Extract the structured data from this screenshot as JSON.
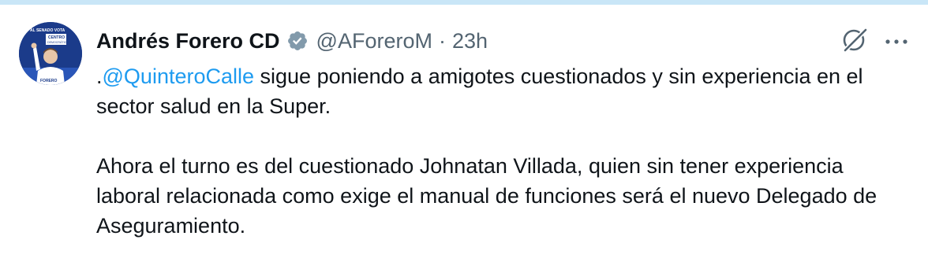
{
  "colors": {
    "accent": "#1d9bf0",
    "verified": "#829aab",
    "secondary_text": "#536471"
  },
  "author": {
    "display_name": "Andrés Forero CD",
    "handle": "@AForeroM",
    "separator": "·",
    "time": "23h",
    "verified_icon": "verified-badge-icon",
    "avatar_text": [
      "AL SENADO VOTA",
      "CENTRO",
      "DEMOCRÁTICO",
      "FORERO"
    ]
  },
  "actions": {
    "grok_icon": "grok-icon",
    "more_icon": "more-options-icon"
  },
  "tweet": {
    "line1_prefix": ".",
    "mention": "@QuinteroCalle",
    "line1_rest": " sigue poniendo a amigotes cuestionados y sin experiencia en el sector salud en la Super.",
    "paragraph2": "Ahora el turno es del cuestionado Johnatan Villada, quien sin tener experiencia laboral relacionada como exige el manual de funciones será el nuevo Delegado de Aseguramiento."
  }
}
